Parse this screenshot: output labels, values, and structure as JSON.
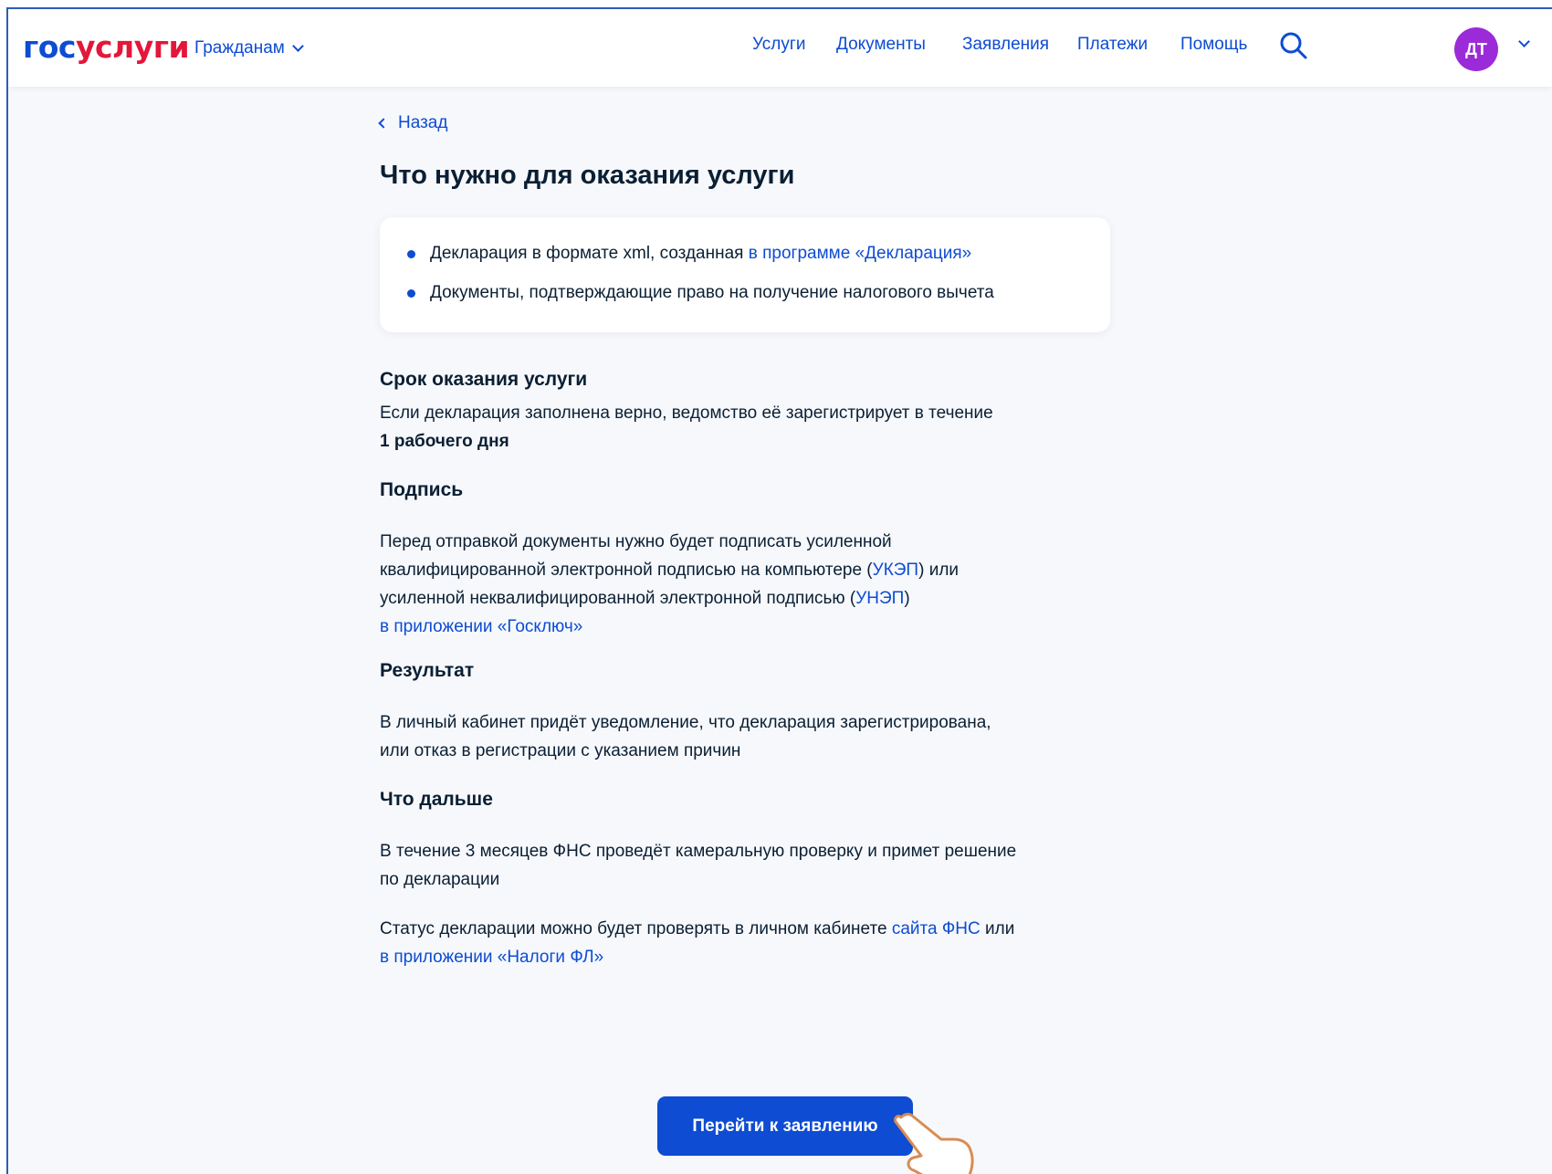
{
  "header": {
    "logo_part1": "гос",
    "logo_part2": "услуги",
    "role_label": "Гражданам",
    "nav": [
      "Услуги",
      "Документы",
      "Заявления",
      "Платежи",
      "Помощь"
    ],
    "avatar_initials": "ДТ",
    "brand_blue": "#0d4cd3",
    "brand_red": "#e4163a",
    "avatar_color": "#9b2bd8"
  },
  "main": {
    "back_label": "Назад",
    "title": "Что нужно для оказания услуги",
    "requirements": {
      "item1_text": "Декларация в формате xml, созданная ",
      "item1_link": "в программе «Декларация»",
      "item2_text": "Документы, подтверждающие право на получение налогового вычета"
    },
    "term": {
      "title": "Срок оказания услуги",
      "line1": "Если декларация заполнена верно, ведомство её зарегистрирует в течение",
      "line2_bold": "1 рабочего дня"
    },
    "signature": {
      "title": "Подпись",
      "line1": "Перед отправкой документы нужно будет подписать усиленной",
      "line2_text": "квалифицированной электронной подписью на компьютере (",
      "line2_link": "УКЭП",
      "line2_end": ") или",
      "line3_text": "усиленной неквалифицированной электронной подписью (",
      "line3_link": "УНЭП",
      "line3_end": ")",
      "line4_link": "в приложении «Госключ»"
    },
    "result": {
      "title": "Результат",
      "line1": "В личный кабинет придёт уведомление, что декларация зарегистрирована,",
      "line2": "или отказ в регистрации с указанием причин"
    },
    "next": {
      "title": "Что дальше",
      "p1_line1": "В течение 3 месяцев ФНС проведёт камеральную проверку и примет решение",
      "p1_line2": "по декларации",
      "p2_text": "Статус декларации можно будет проверять в личном кабинете ",
      "p2_link": "сайта ФНС",
      "p2_end": " или",
      "p2_link2": "в приложении «Налоги ФЛ»"
    },
    "cta_label": "Перейти к заявлению"
  }
}
